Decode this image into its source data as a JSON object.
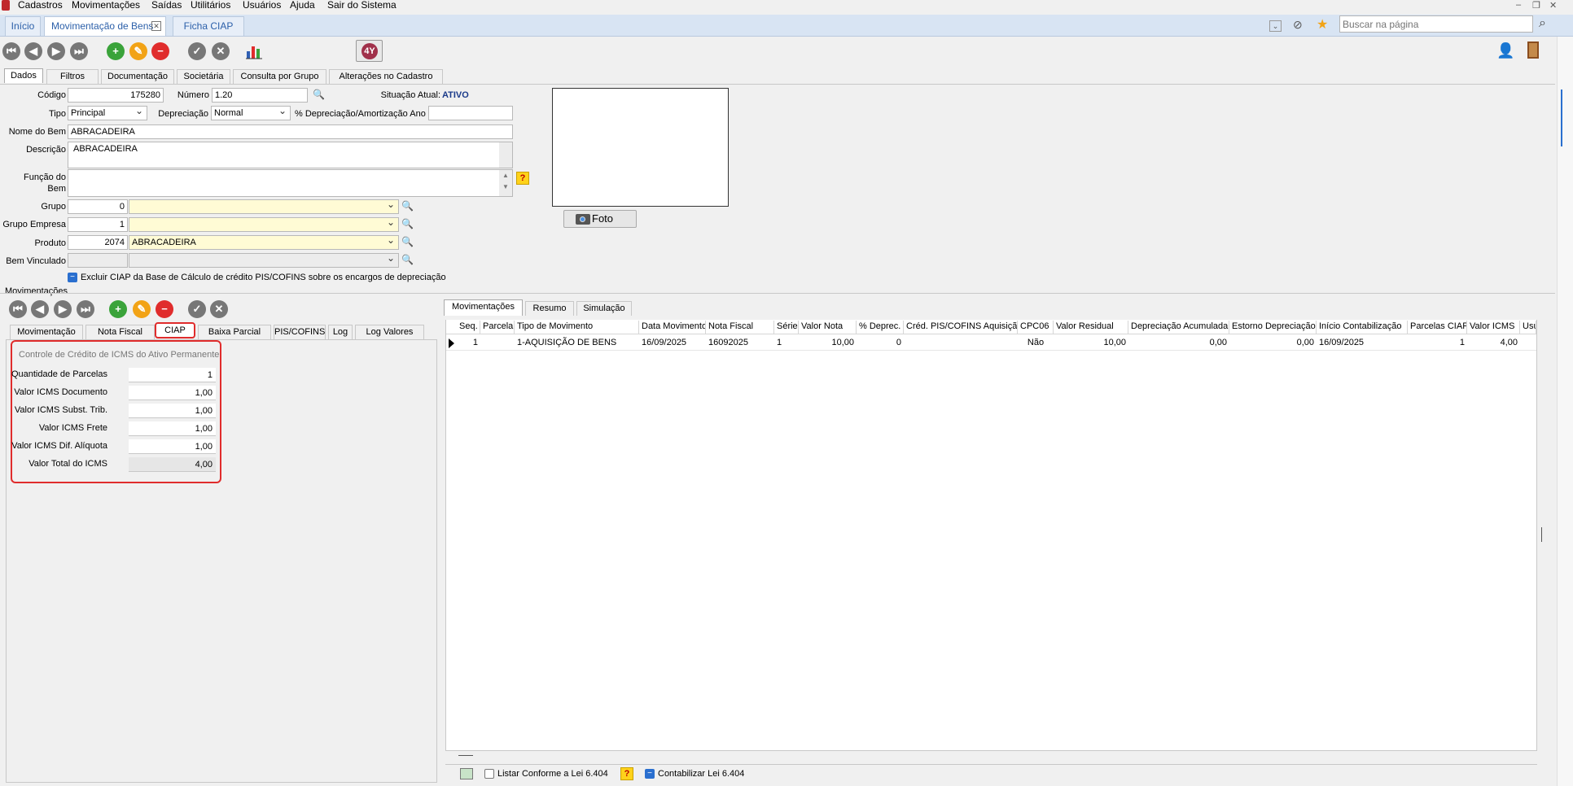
{
  "menu": {
    "items": [
      "Cadastros",
      "Movimentações",
      "Saídas",
      "Utilitários",
      "Usuários",
      "Ajuda",
      "Sair do Sistema"
    ]
  },
  "tabs": {
    "items": [
      "Início",
      "Movimentação de Bens",
      "Ficha CIAP"
    ]
  },
  "search": {
    "placeholder": "Buscar na página"
  },
  "toolbar": {
    "colors": {
      "add": "#3aa33a",
      "edit": "#f2a316",
      "delete": "#e02c2c"
    }
  },
  "main_tabs": [
    "Dados",
    "Filtros",
    "Documentação",
    "Societária",
    "Consulta por Grupo",
    "Alterações no Cadastro"
  ],
  "form": {
    "codigo_label": "Código",
    "codigo": "175280",
    "numero_label": "Número",
    "numero": "1.20",
    "situacao_label": "Situação Atual:",
    "situacao": "ATIVO",
    "tipo_label": "Tipo",
    "tipo": "Principal",
    "depreciacao_label": "Depreciação",
    "depreciacao": "Normal",
    "pct_depreciacao_label": "% Depreciação/Amortização Ano",
    "pct_depreciacao": "",
    "nome_label": "Nome do Bem",
    "nome": "ABRACADEIRA",
    "descricao_label": "Descrição",
    "descricao": "ABRACADEIRA",
    "funcao_label": "Função do Bem",
    "funcao": "",
    "grupo_label": "Grupo",
    "grupo_code": "0",
    "grupo_name": "",
    "grupo_empresa_label": "Grupo Empresa",
    "grupo_empresa_code": "1",
    "grupo_empresa_name": "",
    "produto_label": "Produto",
    "produto_code": "2074",
    "produto_name": "ABRACADEIRA",
    "bem_vinculado_label": "Bem Vinculado",
    "excluir_ciap_label": "Excluir CIAP da Base de Cálculo de crédito PIS/COFINS sobre os encargos de depreciação",
    "foto_label": "Foto"
  },
  "movimentacoes_title": "Movimentações",
  "mov_tabs": [
    "Movimentação",
    "Nota Fiscal",
    "CIAP",
    "Baixa Parcial",
    "PIS/COFINS",
    "Log",
    "Log Valores"
  ],
  "ciap": {
    "title": "Controle de Crédito de ICMS do Ativo Permanente",
    "fields": [
      {
        "label": "Quantidade de Parcelas",
        "value": "1"
      },
      {
        "label": "Valor ICMS Documento",
        "value": "1,00"
      },
      {
        "label": "Valor ICMS Subst. Trib.",
        "value": "1,00"
      },
      {
        "label": "Valor ICMS Frete",
        "value": "1,00"
      },
      {
        "label": "Valor ICMS Dif. Alíquota",
        "value": "1,00"
      },
      {
        "label": "Valor Total do ICMS",
        "value": "4,00"
      }
    ],
    "highlight_color": "#e02c2c"
  },
  "right_tabs": [
    "Movimentações",
    "Resumo",
    "Simulação"
  ],
  "grid": {
    "columns": [
      "Seq.",
      "Parcela",
      "Tipo de Movimento",
      "Data Movimento",
      "Nota Fiscal",
      "Série",
      "Valor Nota",
      "% Deprec.",
      "Créd. PIS/COFINS Aquisição",
      "CPC06",
      "Valor Residual",
      "Depreciação Acumulada",
      "Estorno Depreciação",
      "Início Contabilização",
      "Parcelas CIAP",
      "Valor ICMS",
      "Usu"
    ],
    "rows": [
      [
        "1",
        "",
        "1-AQUISIÇÃO DE BENS",
        "16/09/2025",
        "16092025",
        "1",
        "10,00",
        "0",
        "",
        "Não",
        "10,00",
        "0,00",
        "0,00",
        "16/09/2025",
        "1",
        "4,00",
        ""
      ]
    ]
  },
  "footer": {
    "listar_label": "Listar Conforme a Lei 6.404",
    "contabilizar_label": "Contabilizar Lei 6.404"
  }
}
